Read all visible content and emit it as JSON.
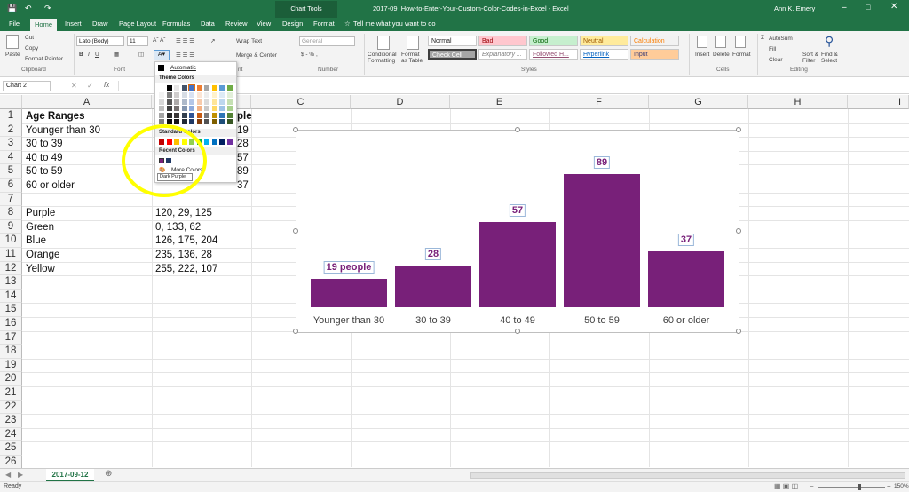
{
  "title": "2017-09_How-to-Enter-Your-Custom-Color-Codes-in-Excel - Excel",
  "chart_tools": "Chart Tools",
  "user": "Ann K. Emery",
  "tabs": [
    "File",
    "Home",
    "Insert",
    "Draw",
    "Page Layout",
    "Formulas",
    "Data",
    "Review",
    "View",
    "Design",
    "Format"
  ],
  "tell_me": "Tell me what you want to do",
  "ribbon": {
    "paste": "Paste",
    "cut": "Cut",
    "copy": "Copy",
    "format_painter": "Format Painter",
    "clipboard": "Clipboard",
    "font_name": "Lato (Body)",
    "font_size": "11",
    "font_group": "Font",
    "wrap_text": "Wrap Text",
    "merge_center": "Merge & Center",
    "alignment_frag": "nt",
    "number_format": "General",
    "number_group": "Number",
    "cond_format": "Conditional Formatting",
    "format_table": "Format as Table",
    "styles": [
      "Normal",
      "Bad",
      "Good",
      "Neutral",
      "Calculation",
      "Check Cell",
      "Explanatory ...",
      "Followed H...",
      "Hyperlink",
      "Input"
    ],
    "styles_group": "Styles",
    "insert": "Insert",
    "delete": "Delete",
    "format": "Format",
    "cells_group": "Cells",
    "autosum": "AutoSum",
    "fill": "Fill",
    "clear": "Clear",
    "sort": "Sort & Filter",
    "find": "Find & Select",
    "editing_group": "Editing"
  },
  "name_box": "Chart 2",
  "fx": "fx",
  "columns": [
    "A",
    "B",
    "C",
    "D",
    "E",
    "F",
    "G",
    "H",
    "I"
  ],
  "rows": [
    "1",
    "2",
    "3",
    "4",
    "5",
    "6",
    "7",
    "8",
    "9",
    "10",
    "11",
    "12",
    "13",
    "14",
    "15",
    "16",
    "17",
    "18",
    "19",
    "20",
    "21",
    "22",
    "23",
    "24",
    "25",
    "26"
  ],
  "cells": {
    "a1": "Age Ranges",
    "b1_frag": "ple",
    "a2": "Younger than 30",
    "b2_frag": "19",
    "a3": "30 to 39",
    "b3_frag": "28",
    "a4": "40 to 49",
    "b4_frag": "57",
    "a5": "50 to 59",
    "b5_frag": "89",
    "a6": "60 or older",
    "b6_frag": "37",
    "a8": "Purple",
    "b8": "120, 29, 125",
    "a9": "Green",
    "b9": "0, 133, 62",
    "a10": "Blue",
    "b10": "126, 175, 204",
    "a11": "Orange",
    "b11": "235, 136, 28",
    "a12": "Yellow",
    "b12": "255, 222, 107"
  },
  "palette": {
    "automatic": "Automatic",
    "theme": "Theme Colors",
    "standard": "Standard Colors",
    "recent": "Recent Colors",
    "more": "More Colors...",
    "tooltip": "Dark Purple"
  },
  "sheet_tab": "2017-09-12",
  "status": "Ready",
  "zoom": "150%",
  "chart_data": {
    "type": "bar",
    "categories": [
      "Younger than 30",
      "30 to 39",
      "40 to 49",
      "50 to 59",
      "60 or older"
    ],
    "values": [
      19,
      28,
      57,
      89,
      37
    ],
    "data_labels": [
      "19 people",
      "28",
      "57",
      "89",
      "37"
    ],
    "ylim": [
      0,
      100
    ],
    "bar_color": "#782079",
    "title": "",
    "xlabel": "",
    "ylabel": ""
  }
}
